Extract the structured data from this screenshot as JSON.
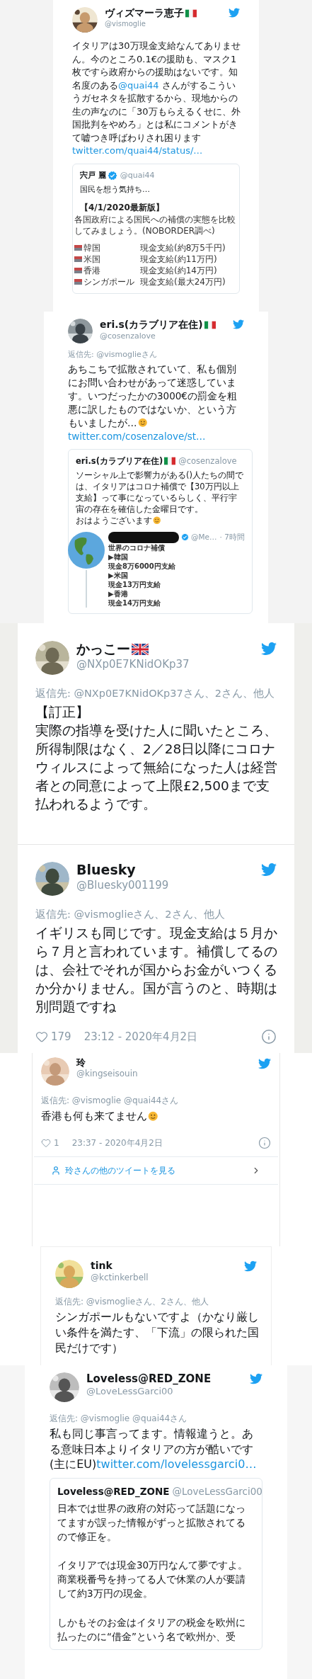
{
  "tweets": [
    {
      "name": "ヴィズマーラ恵子",
      "name_badge": {
        "kind": "italy"
      },
      "handle": "@vismoglie",
      "body": [
        {
          "lines": [
            [
              {
                "kind": "text",
                "text": "イタリアは30万現金支給なんてありません。今のところ0.1€の援助も、マスク1枚ですら政府からの援助はないです。知名度のある"
              },
              {
                "kind": "mention",
                "text": "@quai44"
              },
              {
                "kind": "text",
                "text": " さんがするこういうガセネタを拡散するから、現地からの生の声なのに「30万もらえるくせに、外国批判をやめろ」とは私にコメントがきて嘘つき呼ばわりされ困ります "
              },
              {
                "kind": "link",
                "text": "twitter.com/quai44/status/…"
              }
            ]
          ]
        }
      ],
      "quote": {
        "name": "宍戸 麗",
        "name_badge": {
          "kind": "verified"
        },
        "handle": "@quai44",
        "body": [
          {
            "lines": [
              [
                {
                  "kind": "text",
                  "text": "国民を想う気持ち…"
                }
              ]
            ]
          }
        ],
        "image": {
          "heading": "【4/1/2020最新版】",
          "caption": "各国政府による国民への補償の実態を比較してみましょう。(NOBORDER調べ)",
          "rows": [
            {
              "country": "韓国",
              "amount": "現金支給(約8万5千円)"
            },
            {
              "country": "米国",
              "amount": "現金支給(約11万円)"
            },
            {
              "country": "香港",
              "amount": "現金支給(約14万円)"
            },
            {
              "country": "シンガポール",
              "amount": "現金支給(最大24万円)"
            }
          ]
        }
      }
    },
    {
      "name": "eri.s(カラブリア在住)",
      "name_badge": {
        "kind": "italy"
      },
      "handle": "@cosenzalove",
      "reply_to": "返信先: @vismoglieさん",
      "body": [
        {
          "lines": [
            [
              {
                "kind": "text",
                "text": "あちこちで拡散されていて、私も個別にお問い合わせがあって迷惑しています。いつだったかの3000€の罰金を粗悪に訳したものではないか、という方もいましたが…"
              },
              {
                "kind": "emoji"
              },
              {
                "kind": "link",
                "text": "twitter.com/cosenzalove/st…"
              }
            ]
          ]
        }
      ],
      "quote": {
        "name": "eri.s(カラブリア在住)",
        "name_badge": {
          "kind": "italy"
        },
        "handle": "@cosenzalove",
        "body": [
          {
            "lines": [
              [
                {
                  "kind": "text",
                  "text": "ソーシャル上で影響力がある()人たちの間では、イタリアはコロナ補償で【30万円以上支給】って事になっているらしく、平行宇宙の存在を確信した金曜日です。"
                }
              ],
              [
                {
                  "kind": "text",
                  "text": "おはようございます"
                },
                {
                  "kind": "emoji"
                }
              ]
            ]
          }
        ],
        "embedded": {
          "name_hidden": true,
          "handle": "@Me…",
          "time": "· 7時間",
          "lines": [
            "世界のコロナ補償",
            "▶韓国",
            "現金8万6000円支給",
            "▶米国",
            "現金13万円支給",
            "▶香港",
            "現金14万円支給"
          ]
        }
      }
    },
    {
      "name": "かっこー",
      "name_badge": {
        "kind": "uk"
      },
      "handle": "@NXp0E7KNidOKp37",
      "reply_to": "返信先: @NXp0E7KNidOKp37さん、2さん、他人",
      "body": [
        {
          "lines": [
            [
              {
                "kind": "text",
                "text": "【訂正】"
              }
            ],
            [
              {
                "kind": "text",
                "text": "実際の指導を受けた人に聞いたところ、所得制限はなく、2／28日以降にコロナウィルスによって無給になった人は経営者との同意によって上限£2,500まで支払われるようです。"
              }
            ]
          ]
        }
      ]
    },
    {
      "name": "Bluesky",
      "handle": "@Bluesky001199",
      "reply_to": "返信先: @vismoglieさん、2さん、他人",
      "body": [
        {
          "lines": [
            [
              {
                "kind": "text",
                "text": "イギリスも同じです。現金支給は５月から７月と言われています。補償してるのは、会社でそれが国からお金がいつくるか分かりません。国が言うのと、時期は別問題ですね"
              }
            ]
          ]
        }
      ],
      "likes": "179",
      "time": "23:12 - 2020年4月2日"
    },
    {
      "name": "玲",
      "handle": "@kingseisouin",
      "reply_to": "返信先: @vismoglie @quai44さん",
      "body": [
        {
          "lines": [
            [
              {
                "kind": "text",
                "text": "香港も何も来てません"
              },
              {
                "kind": "emoji"
              }
            ]
          ]
        }
      ],
      "likes": "1",
      "time": "23:37 - 2020年4月2日",
      "more_link": "玲さんの他のツイートを見る"
    },
    {
      "name": "tink",
      "handle": "@kctinkerbell",
      "reply_to": "返信先: @vismoglieさん、2さん、他人",
      "body": [
        {
          "lines": [
            [
              {
                "kind": "text",
                "text": "シンガポールもないですよ（かなり厳しい条件を満たす、「下流」の限られた国民だけです）"
              }
            ]
          ]
        }
      ]
    },
    {
      "name": "Loveless@RED_ZONE",
      "handle": "@LoveLessGarci00",
      "reply_to": "返信先: @vismoglie @quai44さん",
      "body": [
        {
          "lines": [
            [
              {
                "kind": "text",
                "text": "私も同じ事言ってます。情報違うと。ある意味日本よりイタリアの方が酷いです(主にEU)"
              },
              {
                "kind": "link",
                "text": "twitter.com/lovelessgarci0…"
              }
            ]
          ]
        }
      ],
      "quote": {
        "name": "Loveless@RED_ZONE",
        "handle": "@LoveLessGarci00",
        "body": [
          {
            "lines": [
              [
                {
                  "kind": "text",
                  "text": "日本では世界の政府の対応って話題になってますが誤った情報がずっと拡散されてるので修正を。"
                }
              ]
            ]
          },
          {
            "lines": [
              [
                {
                  "kind": "text",
                  "text": "イタリアでは現金30万円なんて夢ですよ。"
                }
              ],
              [
                {
                  "kind": "text",
                  "text": "商業税番号を持ってる人で休業の人が要請して約3万円の現金。"
                }
              ]
            ]
          },
          {
            "lines": [
              [
                {
                  "kind": "text",
                  "text": "しかもそのお金はイタリアの税金を欧州に払ったのに“借金”という名で欧州か、受"
                }
              ]
            ]
          }
        ]
      }
    }
  ]
}
